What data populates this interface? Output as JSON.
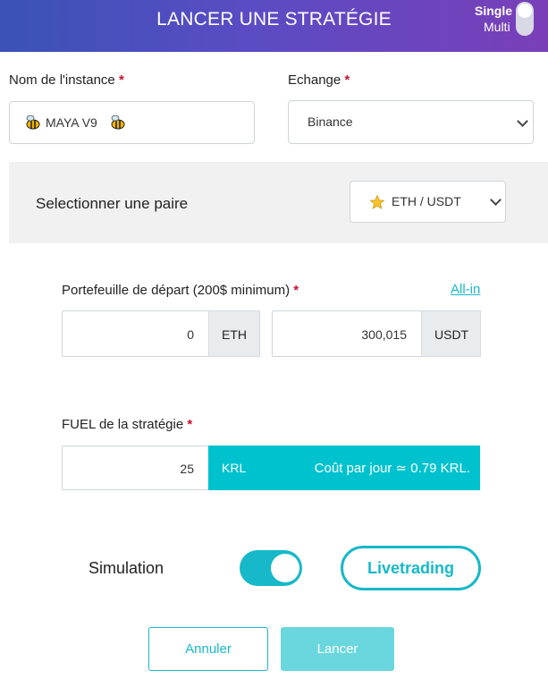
{
  "header": {
    "title": "LANCER UNE STRATÉGIE",
    "mode_single": "Single",
    "mode_multi": "Multi"
  },
  "instance": {
    "label": "Nom de l'instance",
    "required": "*",
    "value": "MAYA  V9",
    "icon": "bee-emoji-icon"
  },
  "exchange": {
    "label": "Echange",
    "required": "*",
    "selected": "Binance"
  },
  "pair": {
    "label": "Selectionner une paire",
    "selected": "ETH / USDT",
    "icon": "star-icon"
  },
  "wallet": {
    "label": "Portefeuille de départ (200$ minimum)",
    "required": "*",
    "allin_link": "All-in",
    "base_amount": "0",
    "base_currency": "ETH",
    "quote_amount": "300,015",
    "quote_currency": "USDT"
  },
  "fuel": {
    "label": "FUEL de la stratégie",
    "required": "*",
    "amount": "25",
    "unit": "KRL",
    "cost_text": "Coût par jour ≃ 0.79 KRL."
  },
  "mode": {
    "simulation_label": "Simulation",
    "simulation_on": true,
    "livetrading_label": "Livetrading"
  },
  "actions": {
    "cancel_label": "Annuler",
    "launch_label": "Lancer"
  },
  "colors": {
    "accent": "#17b8c9",
    "fuel_bar": "#00c2cf",
    "required": "#c8102e",
    "header_start": "#3a53b5",
    "header_end": "#7a3fb8"
  }
}
